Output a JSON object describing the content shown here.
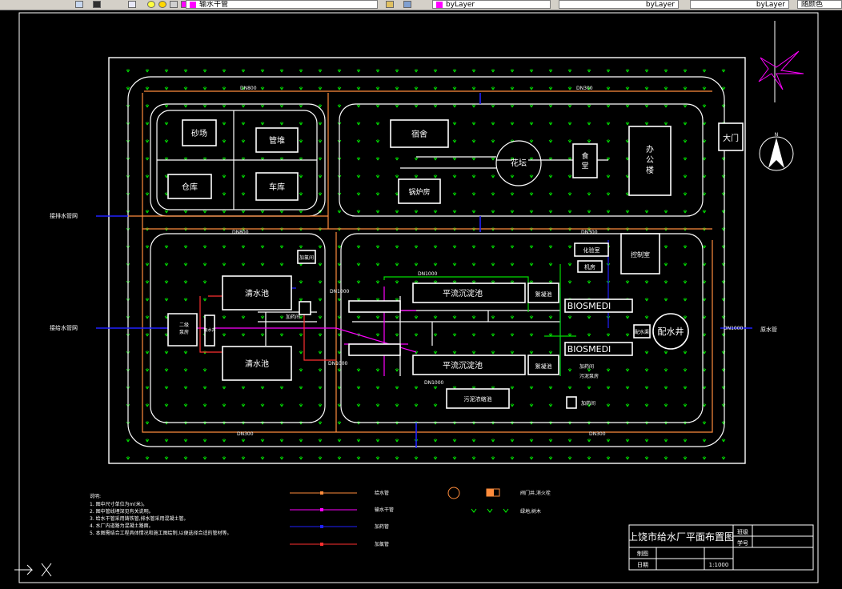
{
  "toolbar": {
    "layer_name": "输水干管",
    "color_value": "byLayer",
    "linetype_value": "byLayer",
    "lineweight_value": "byLayer",
    "plot_style": "随颜色"
  },
  "pipes": {
    "dn800_top": "DN800",
    "dn300_top": "DN300",
    "dn800_mid": "DN800",
    "dn300_mid": "DN300",
    "dn1000_a": "DN1000",
    "dn1000_b": "DN1000",
    "dn1000_c": "DN1000",
    "dn1000_d": "DN1000",
    "dn1000_out": "DN1000",
    "dn300_bottom_left": "DN300",
    "dn300_bottom_right": "DN300"
  },
  "buildings": {
    "sand_field": "砂场",
    "pipe_pile": "管堆",
    "warehouse": "仓库",
    "garage": "车库",
    "dormitory": "宿舍",
    "boiler_room": "锅炉房",
    "flower_bed": "花坛",
    "canteen": "食堂",
    "office": "办公楼",
    "gate": "大门",
    "clear_pool_1": "清水池",
    "clear_pool_2": "清水池",
    "pump_house": "二级泵房",
    "pipe_gallery": "吸水井",
    "dosing_1": "加氯间",
    "dosing_top": "加药间",
    "sed_tank_1": "平流沉淀池",
    "sed_tank_2": "平流沉淀池",
    "mixing_1": "絮凝池",
    "mixing_2": "絮凝池",
    "biosmedi_1": "BIOSMEDI",
    "biosmedi_2": "BIOSMEDI",
    "well": "配水井",
    "distributor": "配水渠",
    "lab": "化验室",
    "machine_room": "机房",
    "control_room": "控制室",
    "sludge": "污泥浓缩池",
    "dosing_2": "加药间",
    "small_1": "加药间",
    "small_2": "污泥泵房"
  },
  "inlets": {
    "left_top": "接排水管网",
    "left_mid": "接给水管网",
    "right_out": "原水管"
  },
  "notes": {
    "title": "说明:",
    "lines": [
      "1. 图中尺寸单位为m(米)。",
      "2. 图中管线埋深见有关说明。",
      "3. 给水干管采用铸铁管,排水管采用混凝土管。",
      "4. 水厂内道路为混凝土路面。",
      "5. 本图需结合工程具体情况和施工图绘制,以便选择合适的管材等。"
    ]
  },
  "legend": {
    "items": [
      "给水管",
      "输水干管",
      "加药管",
      "加氯管"
    ],
    "sym_labels": [
      "阀门井,消火栓",
      "绿地,树木"
    ]
  },
  "title_block": {
    "title": "上饶市给水厂平面布置图",
    "class_label": "班级",
    "student_label": "学号",
    "draw_label": "制图",
    "date_label": "日期",
    "scale": "1:1000"
  },
  "colors": {
    "road": "#ffffff",
    "supply_pipe": "#ff8c3c",
    "main_pipe": "#ff00ff",
    "dosing_pipe": "#2020ff",
    "green": "#00ff00",
    "sludge_pipe": "#ff3030"
  }
}
